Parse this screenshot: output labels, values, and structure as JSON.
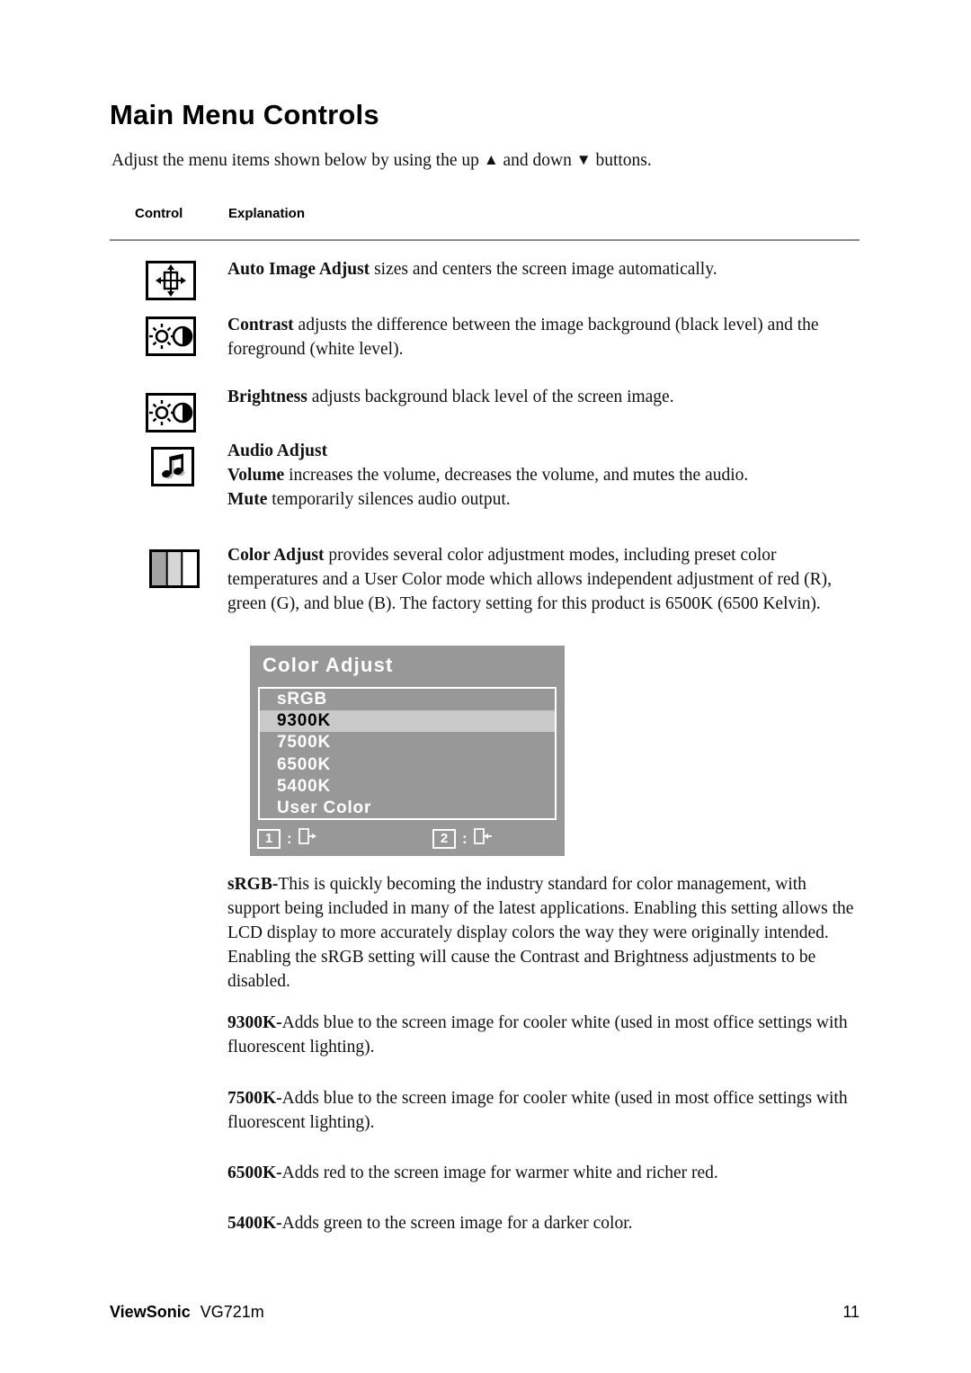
{
  "document": {
    "title": "Main Menu Controls",
    "intro_before": "Adjust the menu items shown below by using the up ",
    "intro_up_glyph": "▲",
    "intro_middle": " and down ",
    "intro_down_glyph": "▼",
    "intro_after": " buttons.",
    "column_headers": {
      "control": "Control",
      "explanation": "Explanation"
    }
  },
  "controls": [
    {
      "icon": "auto-image-adjust-icon",
      "bold": "Auto Image Adjust",
      "text": " sizes and centers the screen image automatically."
    },
    {
      "icon": "contrast-icon",
      "bold": "Contrast",
      "text": " adjusts the difference between the image background  (black level) and the foreground (white level)."
    },
    {
      "icon": "brightness-icon",
      "bold": "Brightness",
      "text": " adjusts background black level of the screen image."
    },
    {
      "icon": "audio-adjust-icon",
      "heading": "Audio Adjust",
      "bold_volume": "Volume",
      "text_volume": " increases the volume, decreases the volume, and mutes the audio.",
      "bold_mute": "Mute",
      "text_mute": " temporarily silences audio output."
    },
    {
      "icon": "color-adjust-icon",
      "bold": "Color Adjust",
      "text": " provides several color adjustment modes, including preset color temperatures and a User Color mode which allows independent adjustment of red (R), green (G), and blue (B). The factory setting for this product is 6500K (6500 Kelvin)."
    }
  ],
  "osd": {
    "title": "Color Adjust",
    "items": [
      {
        "label": "sRGB",
        "selected": false
      },
      {
        "label": "9300K",
        "selected": true
      },
      {
        "label": "7500K",
        "selected": false
      },
      {
        "label": "6500K",
        "selected": false
      },
      {
        "label": "5400K",
        "selected": false
      },
      {
        "label": "User Color",
        "selected": false
      }
    ],
    "footer": {
      "key1": "1",
      "key1_icon": "exit-icon",
      "key2": "2",
      "key2_icon": "enter-icon",
      "separator": ":"
    },
    "colors": {
      "background": "#989898",
      "selected_row": "#c9c9c9",
      "text": "#ffffff",
      "selected_text": "#000000",
      "border": "#ffffff"
    }
  },
  "descriptions": [
    {
      "bold": "sRGB-",
      "text": "This is quickly becoming the industry standard for color management, with support being included in many of the latest applications. Enabling this setting allows the LCD display to more accurately display colors the way they were originally intended. Enabling the sRGB setting will cause the Contrast and Brightness adjustments to be disabled."
    },
    {
      "bold": "9300K-",
      "text": "Adds blue to the screen image for cooler white (used in most office settings with fluorescent lighting)."
    },
    {
      "bold": "7500K-",
      "text": "Adds blue to the screen image for cooler white (used in most office settings with fluorescent lighting)."
    },
    {
      "bold": "6500K-",
      "text": "Adds red to the screen image for warmer white and richer red."
    },
    {
      "bold": "5400K-",
      "text": "Adds green to the screen image for a darker color."
    }
  ],
  "footer": {
    "brand": "ViewSonic",
    "model": "VG721m",
    "page_number": "11"
  }
}
